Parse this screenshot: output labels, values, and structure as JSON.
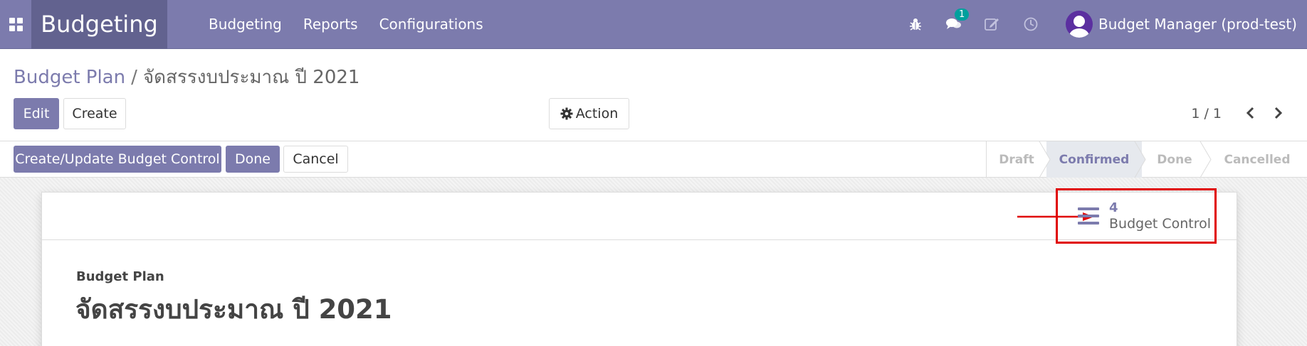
{
  "navbar": {
    "app_title": "Budgeting",
    "menu": [
      "Budgeting",
      "Reports",
      "Configurations"
    ],
    "chat_badge": "1",
    "user_name": "Budget Manager (prod-test)",
    "icons": [
      "bug-icon",
      "chat-icon",
      "edit-icon",
      "clock-icon"
    ],
    "bg_color": "#7c7bad"
  },
  "breadcrumb": {
    "parent": "Budget Plan",
    "separator": "/",
    "current": "จัดสรรงบประมาณ ปี 2021"
  },
  "buttons": {
    "edit": "Edit",
    "create": "Create",
    "action": "Action"
  },
  "pager": {
    "text": "1 / 1"
  },
  "header_buttons": {
    "create_update": "Create/Update Budget Control",
    "done": "Done",
    "cancel": "Cancel"
  },
  "stages": {
    "items": [
      "Draft",
      "Confirmed",
      "Done",
      "Cancelled"
    ],
    "active": "Confirmed"
  },
  "smart_button": {
    "count": "4",
    "label": "Budget Control"
  },
  "form": {
    "field_label": "Budget Plan",
    "record_name": "จัดสรรงบประมาณ ปี 2021"
  }
}
